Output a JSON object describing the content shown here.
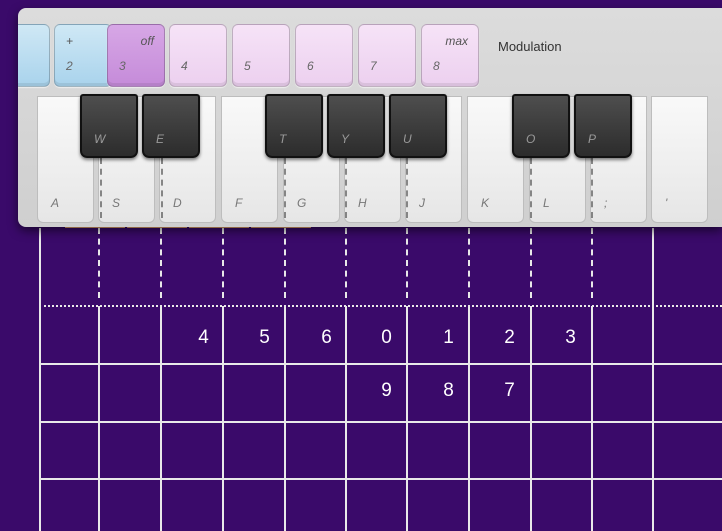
{
  "controls": [
    {
      "top": "",
      "bottom": "",
      "style": "blue"
    },
    {
      "top": "+",
      "bottom": "2",
      "style": "blue"
    },
    {
      "top": "off",
      "bottom": "3",
      "style": "purple"
    },
    {
      "top": "",
      "bottom": "4",
      "style": "pink"
    },
    {
      "top": "",
      "bottom": "5",
      "style": "pink"
    },
    {
      "top": "",
      "bottom": "6",
      "style": "pink"
    },
    {
      "top": "",
      "bottom": "7",
      "style": "pink"
    },
    {
      "top": "max",
      "bottom": "8",
      "style": "pink"
    }
  ],
  "modulation_label": "Modulation",
  "white_keys": [
    "A",
    "S",
    "D",
    "F",
    "G",
    "H",
    "J",
    "K",
    "L",
    ";",
    "'"
  ],
  "black_keys": [
    "W",
    "E",
    "T",
    "Y",
    "U",
    "O",
    "P"
  ],
  "grid": {
    "row1": [
      "",
      "",
      "4",
      "5",
      "6",
      "0",
      "1",
      "2",
      "3",
      "",
      ""
    ],
    "row2": [
      "",
      "",
      "",
      "",
      "",
      "9",
      "8",
      "7",
      "",
      "",
      ""
    ]
  },
  "colors": {
    "background": "#3a0a6a",
    "grid_lines": "#e9e9e9",
    "control_blue": "#a9d3ec",
    "control_purple": "#c58bd9",
    "control_pink": "#ecd0ef",
    "tab_orange": "#f3b07a"
  }
}
